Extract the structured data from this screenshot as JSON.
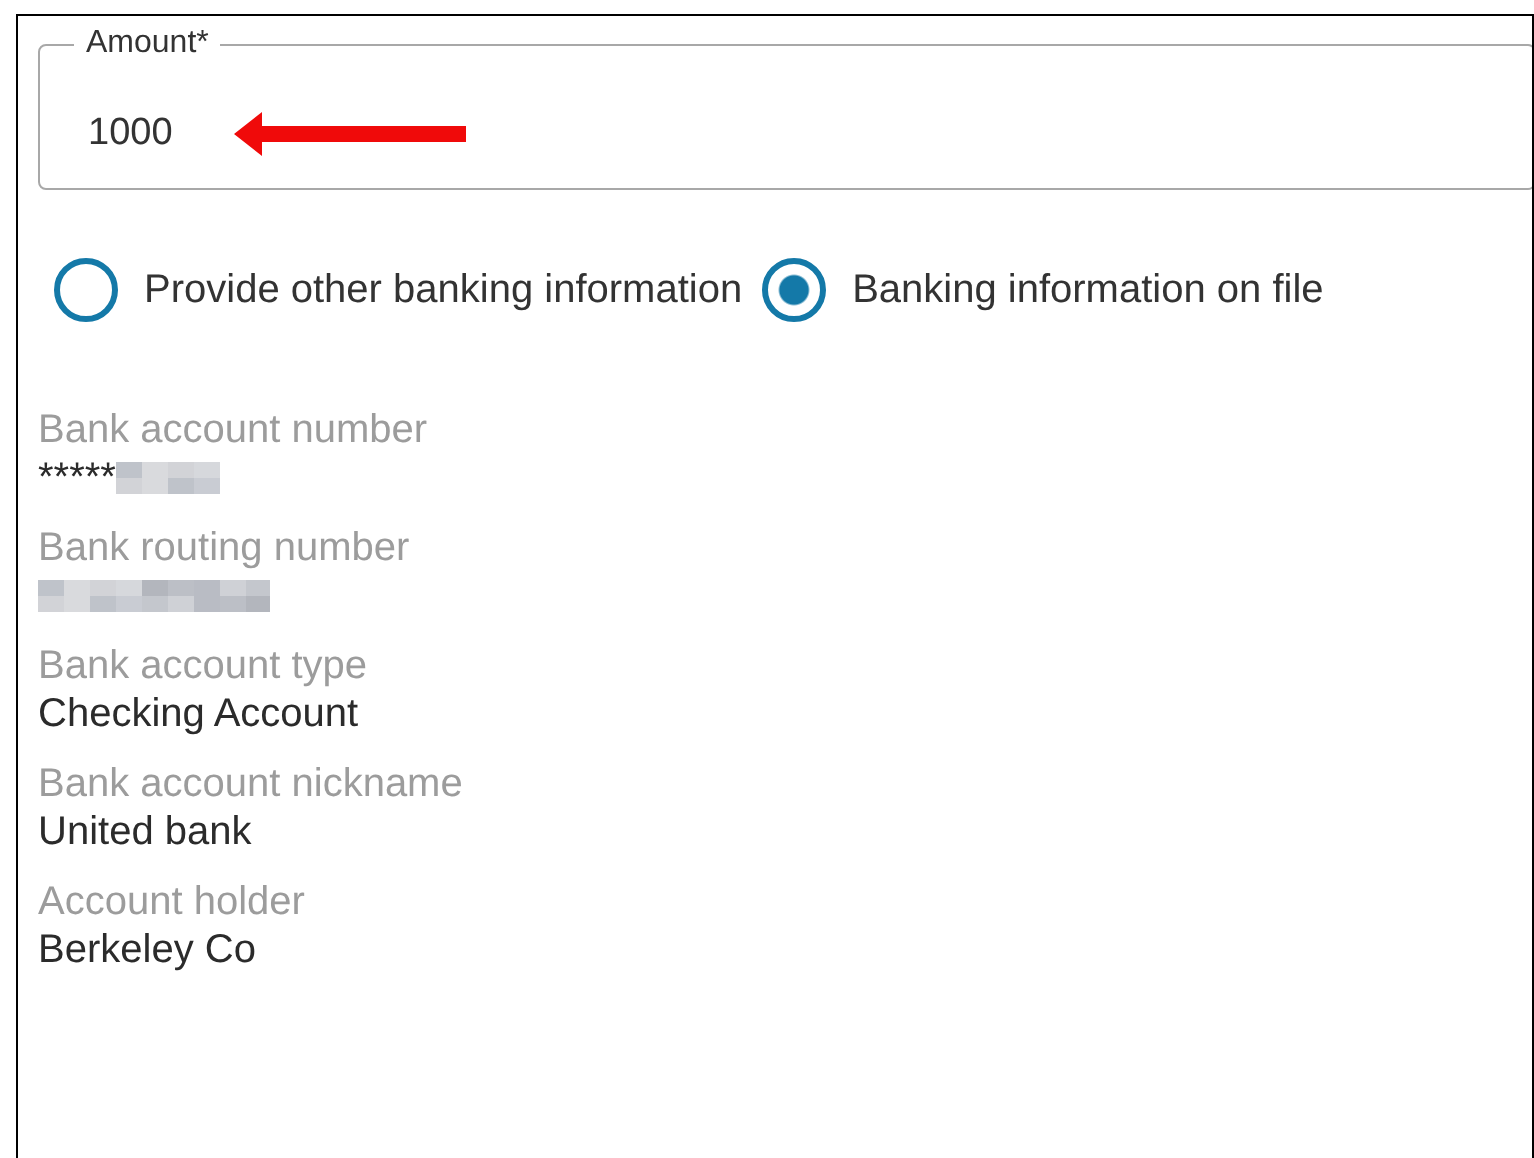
{
  "amount_field": {
    "label": "Amount*",
    "value": "1000"
  },
  "radios": [
    {
      "label": "Provide other banking information",
      "selected": false
    },
    {
      "label": "Banking information on file",
      "selected": true
    }
  ],
  "details": [
    {
      "label": "Bank account number",
      "value": "*****",
      "redacted": true
    },
    {
      "label": "Bank routing number",
      "redacted": true
    },
    {
      "label": "Bank account type",
      "value": "Checking Account",
      "redacted": false
    },
    {
      "label": "Bank account nickname",
      "value": "United bank",
      "redacted": false
    },
    {
      "label": "Account holder",
      "value": "Berkeley Co",
      "redacted": false
    }
  ]
}
